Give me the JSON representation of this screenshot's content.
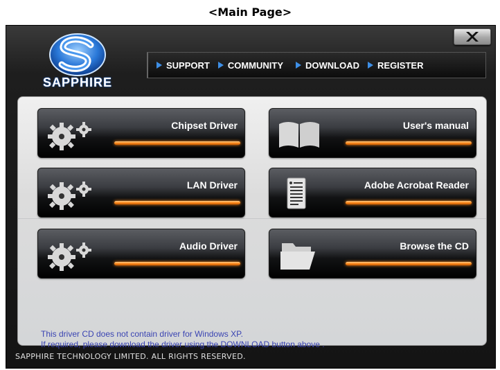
{
  "caption": "<Main Page>",
  "window": {
    "close_label": "X"
  },
  "brand": {
    "name": "SAPPHIRE"
  },
  "nav": {
    "items": [
      {
        "label": "SUPPORT"
      },
      {
        "label": "COMMUNITY"
      },
      {
        "label": "DOWNLOAD"
      },
      {
        "label": "REGISTER"
      }
    ]
  },
  "tiles": [
    {
      "label": "Chipset Driver",
      "icon": "gears-icon"
    },
    {
      "label": "User's manual",
      "icon": "open-book-icon"
    },
    {
      "label": "LAN Driver",
      "icon": "gears-icon"
    },
    {
      "label": "Adobe Acrobat Reader",
      "icon": "document-icon"
    },
    {
      "label": "Audio Driver",
      "icon": "gears-icon"
    },
    {
      "label": "Browse the CD",
      "icon": "folder-icon"
    }
  ],
  "notice": {
    "line1": "This driver CD does not contain driver for Windows XP.",
    "line2": "If required, please download the driver using the DOWNLOAD button above ."
  },
  "footer": {
    "text": "SAPPHIRE TECHNOLOGY LIMITED. ALL RIGHTS RESERVED."
  },
  "colors": {
    "accent_orange": "#ff8a1e",
    "nav_arrow_blue": "#3e8fe6",
    "notice_text": "#3a44b2"
  }
}
